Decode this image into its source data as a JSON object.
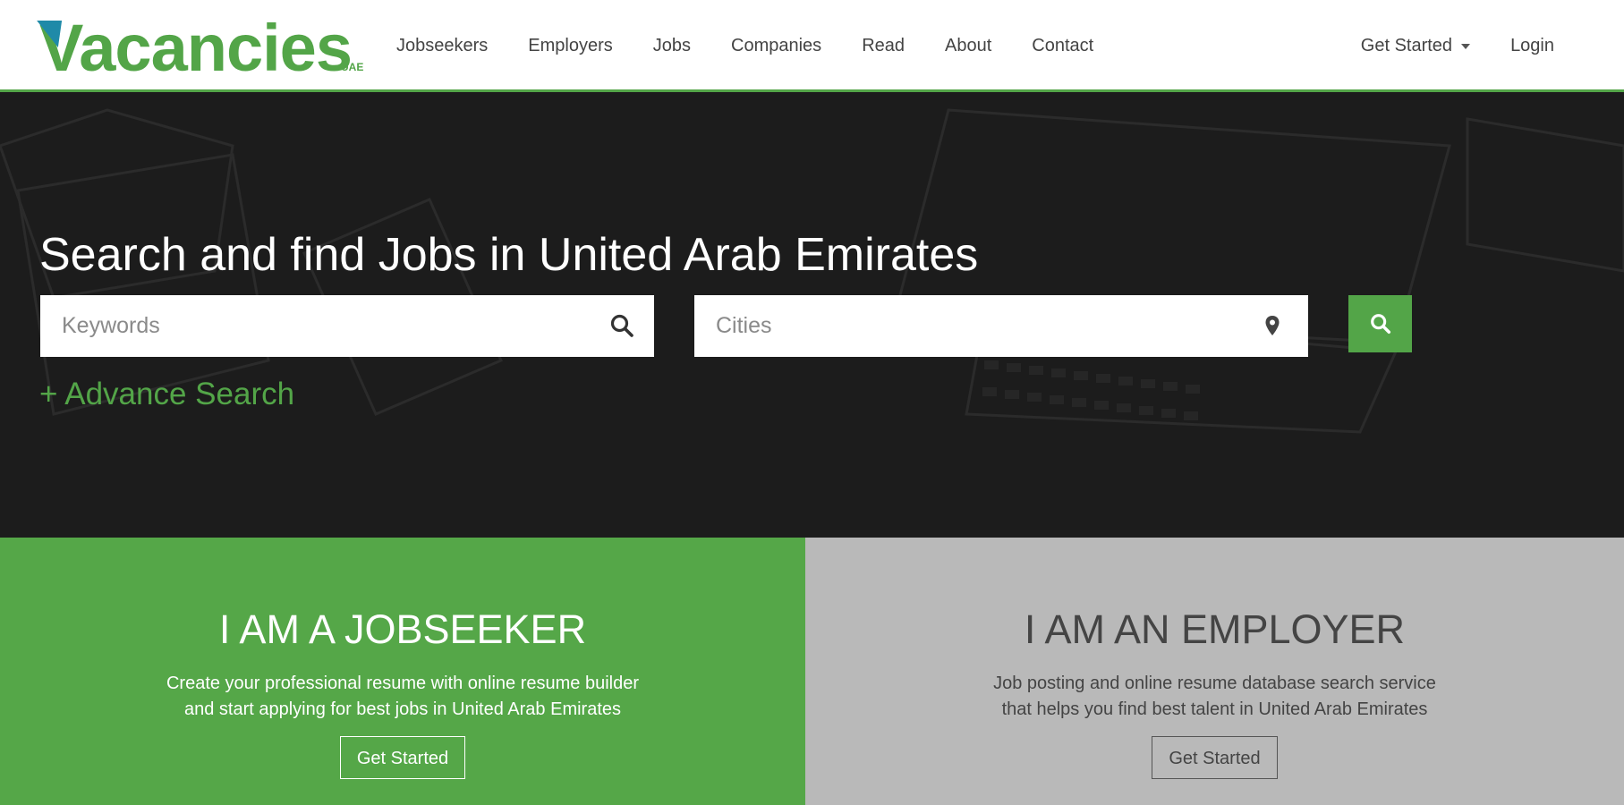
{
  "brand": {
    "logo_text": "Vacancies",
    "logo_sub": "UAE",
    "accent_color": "#53a548",
    "v_accent_color": "#1f8aa8"
  },
  "nav": {
    "items": [
      "Jobseekers",
      "Employers",
      "Jobs",
      "Companies",
      "Read",
      "About",
      "Contact"
    ],
    "get_started": "Get Started",
    "login": "Login"
  },
  "hero": {
    "title": "Search and find Jobs in United Arab Emirates",
    "keywords_placeholder": "Keywords",
    "cities_placeholder": "Cities",
    "advance_search": "+ Advance Search",
    "icons": {
      "keywords": "search-icon",
      "cities": "map-pin-icon",
      "button": "search-icon"
    }
  },
  "panels": {
    "jobseeker": {
      "title": "I AM A JOBSEEKER",
      "line1": "Create your professional resume with online resume builder",
      "line2": "and start applying for best jobs in United Arab Emirates",
      "button": "Get Started",
      "bg_color": "#55a748"
    },
    "employer": {
      "title": "I AM AN EMPLOYER",
      "line1": "Job posting and online resume database search service",
      "line2": "that helps you find best talent in United Arab Emirates",
      "button": "Get Started",
      "bg_color": "#b9b9b9"
    }
  }
}
